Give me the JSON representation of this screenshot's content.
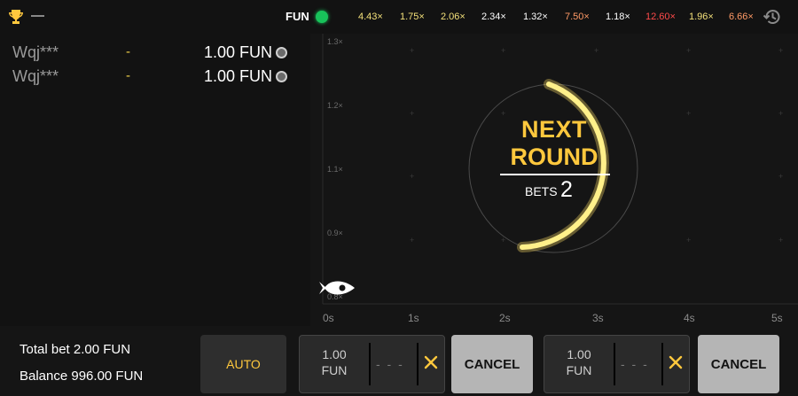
{
  "topbar": {
    "trophy_text": "—",
    "currency": "FUN",
    "multipliers": [
      {
        "value": "4.43×",
        "color": "#f3e07a"
      },
      {
        "value": "1.75×",
        "color": "#f3e07a"
      },
      {
        "value": "2.06×",
        "color": "#f3e07a"
      },
      {
        "value": "2.34×",
        "color": "#ffffff"
      },
      {
        "value": "1.32×",
        "color": "#ffffff"
      },
      {
        "value": "7.50×",
        "color": "#ff9a66"
      },
      {
        "value": "1.18×",
        "color": "#ffffff"
      },
      {
        "value": "12.60×",
        "color": "#ff4a4a"
      },
      {
        "value": "1.96×",
        "color": "#f3e07a"
      },
      {
        "value": "6.66×",
        "color": "#ff9a66"
      }
    ]
  },
  "bets": [
    {
      "user": "Wqj***",
      "multiplier": "-",
      "amount": "1.00 FUN"
    },
    {
      "user": "Wqj***",
      "multiplier": "-",
      "amount": "1.00 FUN"
    }
  ],
  "graph": {
    "y_labels": [
      "1.3×",
      "1.2×",
      "1.1×",
      "0.9×",
      "0.8×"
    ],
    "x_labels": [
      "0s",
      "1s",
      "2s",
      "3s",
      "4s",
      "5s"
    ]
  },
  "next_round": {
    "line1": "NEXT",
    "line2": "ROUND",
    "bets_label": "BETS",
    "bets_count": "2"
  },
  "bottom": {
    "total_bet": "Total bet 2.00 FUN",
    "balance": "Balance 996.00 FUN",
    "auto_label": "AUTO",
    "bet1": {
      "amount_line1": "1.00",
      "amount_line2": "FUN",
      "auto_cashout": "- - -"
    },
    "bet2": {
      "amount_line1": "1.00",
      "amount_line2": "FUN",
      "auto_cashout": "- - -"
    },
    "cancel_label": "CANCEL"
  },
  "colors": {
    "accent": "#ffc83d",
    "status_online": "#18c25a",
    "background": "#151515"
  }
}
